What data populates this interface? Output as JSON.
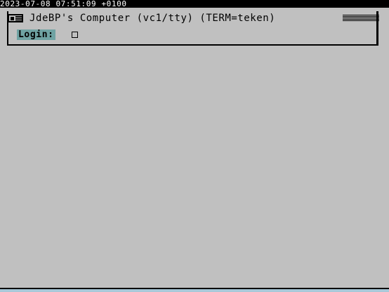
{
  "status_bar": {
    "clock": "2023-07-08 07:51:09 +0100"
  },
  "window": {
    "title": "JdeBP's Computer (vc1/tty) (TERM=teken)",
    "menu_icon": "window-menu-icon",
    "grip_icon": "window-grip-icon"
  },
  "login": {
    "label": "Login:",
    "value": ""
  },
  "colors": {
    "background": "#c0c0c0",
    "status_bar": "#000000",
    "login_highlight": "#6fa3a3"
  }
}
